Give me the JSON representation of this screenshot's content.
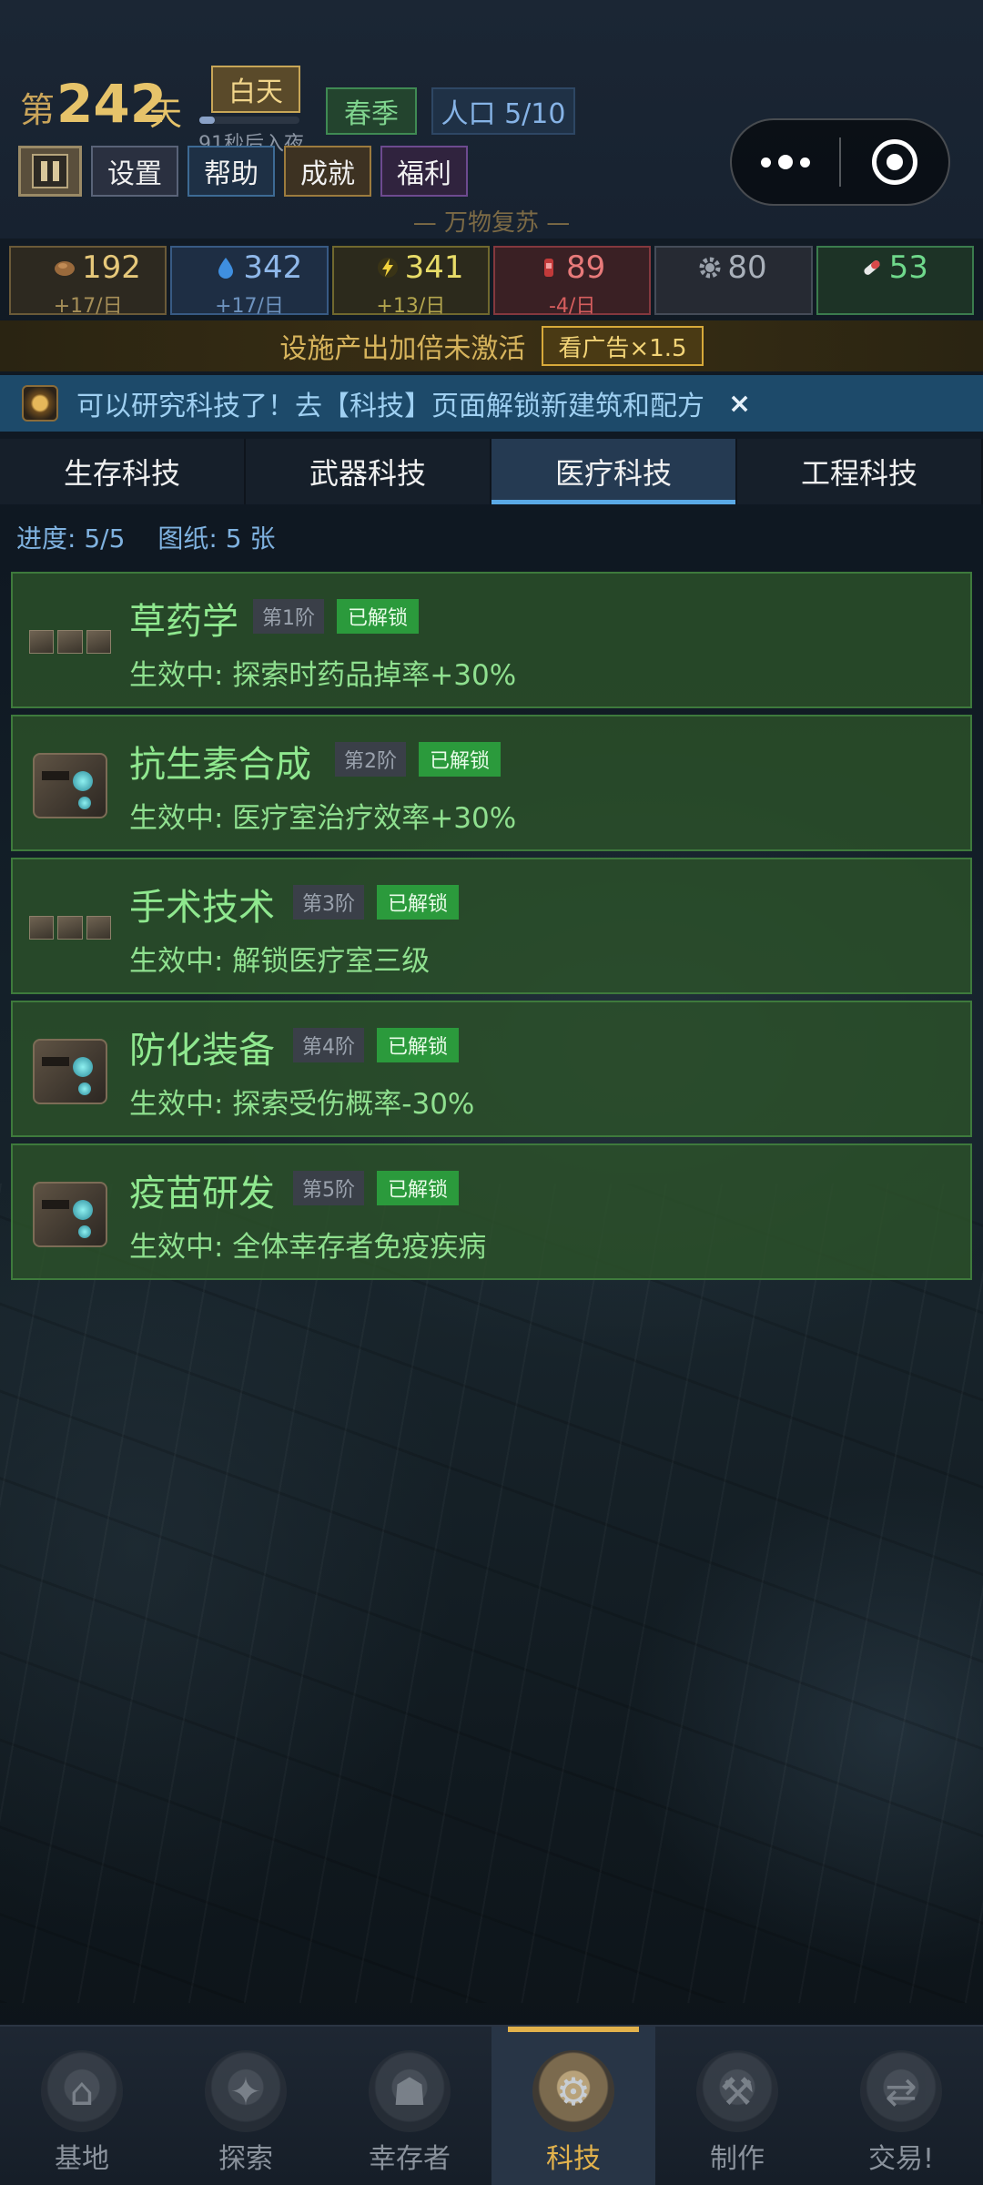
{
  "header": {
    "day_prefix": "第",
    "day_number": "242",
    "day_suffix": "天",
    "daytime": "白天",
    "night_countdown": "91秒后入夜",
    "night_progress": 0.15,
    "season": "春季",
    "population": "人口 5/10",
    "buttons": {
      "settings": "设置",
      "help": "帮助",
      "achievements": "成就",
      "welfare": "福利"
    },
    "motto": "— 万物复苏 —"
  },
  "resources": [
    {
      "value": "192",
      "rate": "+17/日",
      "icon": "food-icon"
    },
    {
      "value": "342",
      "rate": "+17/日",
      "icon": "water-drop-icon"
    },
    {
      "value": "341",
      "rate": "+13/日",
      "icon": "lightning-icon"
    },
    {
      "value": "89",
      "rate": "-4/日",
      "icon": "medicine-icon"
    },
    {
      "value": "80",
      "rate": "",
      "icon": "gear-icon"
    },
    {
      "value": "53",
      "rate": "",
      "icon": "pill-icon"
    }
  ],
  "boost": {
    "text": "设施产出加倍未激活",
    "button": "看广告×1.5"
  },
  "notice": {
    "text": "可以研究科技了！去【科技】页面解锁新建筑和配方",
    "close": "×"
  },
  "tabs": [
    "生存科技",
    "武器科技",
    "医疗科技",
    "工程科技"
  ],
  "active_tab": 2,
  "progress": {
    "progress_text": "进度: 5/5",
    "blueprints_text": "图纸: 5 张"
  },
  "techs": [
    {
      "name": "草药学",
      "tier": "第1阶",
      "status": "已解锁",
      "effect": "生效中: 探索时药品掉率+30%",
      "image": "crates"
    },
    {
      "name": "抗生素合成",
      "tier": "第2阶",
      "status": "已解锁",
      "effect": "生效中: 医疗室治疗效率+30%",
      "image": "machine"
    },
    {
      "name": "手术技术",
      "tier": "第3阶",
      "status": "已解锁",
      "effect": "生效中: 解锁医疗室三级",
      "image": "crates"
    },
    {
      "name": "防化装备",
      "tier": "第4阶",
      "status": "已解锁",
      "effect": "生效中: 探索受伤概率-30%",
      "image": "machine"
    },
    {
      "name": "疫苗研发",
      "tier": "第5阶",
      "status": "已解锁",
      "effect": "生效中: 全体幸存者免疫疾病",
      "image": "machine"
    }
  ],
  "nav": [
    {
      "label": "基地",
      "icon": "base-icon"
    },
    {
      "label": "探索",
      "icon": "compass-icon"
    },
    {
      "label": "幸存者",
      "icon": "survivors-icon"
    },
    {
      "label": "科技",
      "icon": "tech-gear-icon"
    },
    {
      "label": "制作",
      "icon": "crafting-icon"
    },
    {
      "label": "交易!",
      "icon": "trade-icon"
    }
  ],
  "active_nav": 3
}
